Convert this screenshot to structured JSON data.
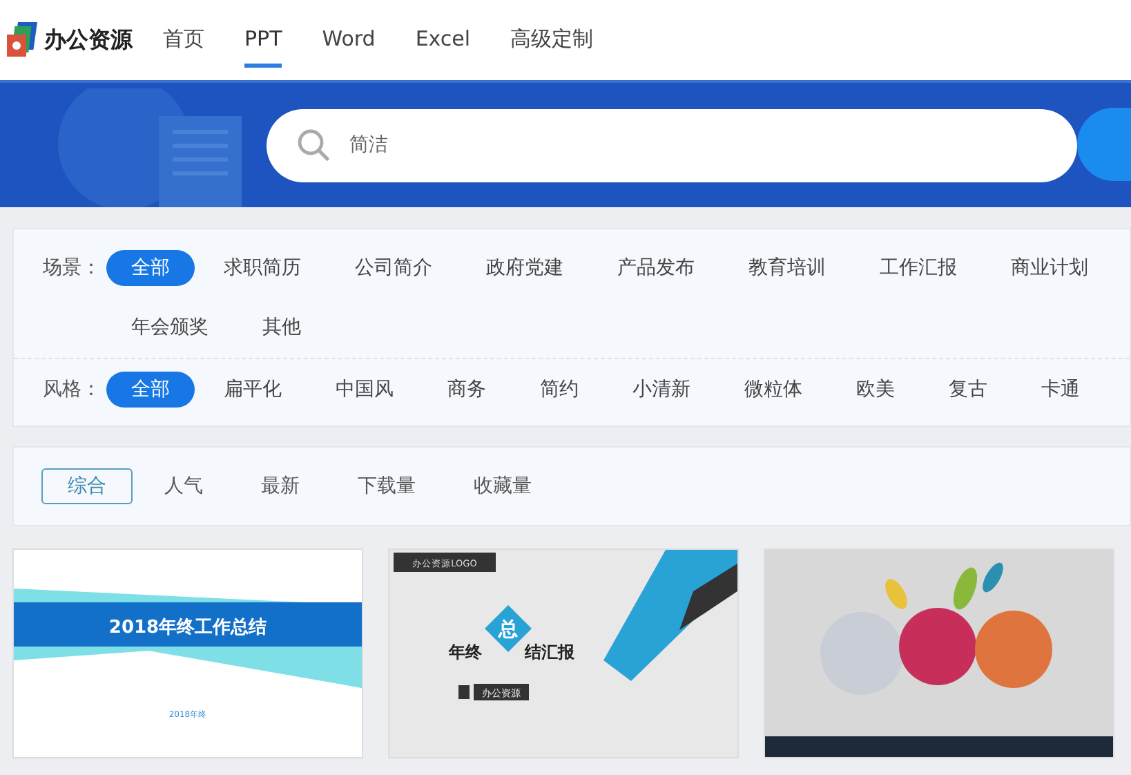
{
  "header": {
    "logo_text": "办公资源",
    "nav": [
      {
        "label": "首页",
        "selected": false
      },
      {
        "label": "PPT",
        "selected": true
      },
      {
        "label": "Word",
        "selected": false
      },
      {
        "label": "Excel",
        "selected": false
      },
      {
        "label": "高级定制",
        "selected": false
      }
    ]
  },
  "banner": {
    "search": {
      "placeholder": "简洁"
    }
  },
  "filters": [
    {
      "label": "场景：",
      "options": [
        {
          "label": "全部",
          "selected": true
        },
        {
          "label": "求职简历",
          "selected": false
        },
        {
          "label": "公司简介",
          "selected": false
        },
        {
          "label": "政府党建",
          "selected": false
        },
        {
          "label": "产品发布",
          "selected": false
        },
        {
          "label": "教育培训",
          "selected": false
        },
        {
          "label": "工作汇报",
          "selected": false
        },
        {
          "label": "商业计划",
          "selected": false
        },
        {
          "label": "年会颁奖",
          "selected": false
        },
        {
          "label": "其他",
          "selected": false
        }
      ]
    },
    {
      "label": "风格：",
      "options": [
        {
          "label": "全部",
          "selected": true
        },
        {
          "label": "扁平化",
          "selected": false
        },
        {
          "label": "中国风",
          "selected": false
        },
        {
          "label": "商务",
          "selected": false
        },
        {
          "label": "简约",
          "selected": false
        },
        {
          "label": "小清新",
          "selected": false
        },
        {
          "label": "微粒体",
          "selected": false
        },
        {
          "label": "欧美",
          "selected": false
        },
        {
          "label": "复古",
          "selected": false
        },
        {
          "label": "卡通",
          "selected": false
        }
      ]
    }
  ],
  "sort": [
    {
      "label": "综合",
      "selected": true
    },
    {
      "label": "人气",
      "selected": false
    },
    {
      "label": "最新",
      "selected": false
    },
    {
      "label": "下载量",
      "selected": false
    },
    {
      "label": "收藏量",
      "selected": false
    }
  ],
  "cards": [
    {
      "kind": "stripes",
      "title": "2018年终工作总结",
      "subtitle": "2018年终"
    },
    {
      "kind": "diamond",
      "logo": "办公资源LOGO",
      "left": "年终",
      "mark": "总",
      "right": "结汇报",
      "tag": "办公资源"
    },
    {
      "kind": "splash"
    }
  ]
}
